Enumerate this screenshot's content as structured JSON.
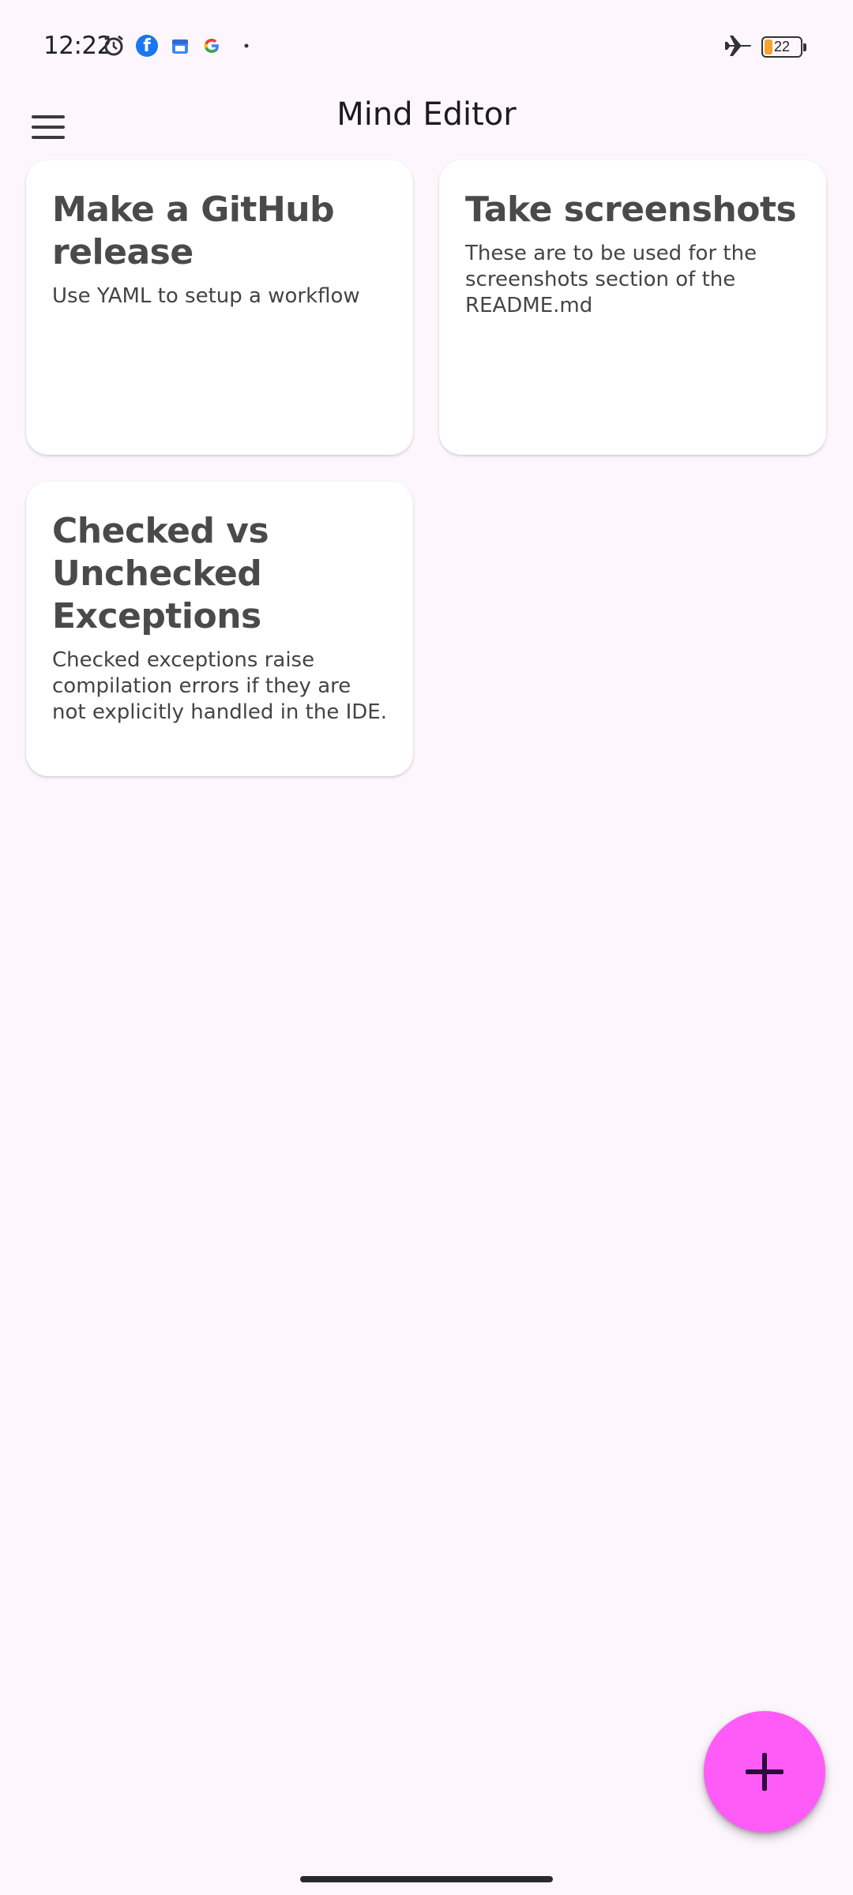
{
  "status_bar": {
    "time": "12:22",
    "icons": [
      "alarm-icon",
      "facebook-icon",
      "calendar-icon",
      "google-icon",
      "dot-icon",
      "airplane-mode-icon",
      "battery-icon"
    ],
    "battery_level": "22",
    "battery_color": "#f3a530"
  },
  "app_bar": {
    "title": "Mind Editor",
    "menu_icon": "hamburger-menu-icon"
  },
  "notes": [
    {
      "title": "Make a GitHub release",
      "body": "Use YAML to setup a workflow"
    },
    {
      "title": "Take screenshots",
      "body": "These are to be used for the screenshots section of the README.md"
    },
    {
      "title": "Checked vs Unchecked Exceptions",
      "body": "Checked exceptions raise compilation errors if they are not explicitly handled in the IDE."
    }
  ],
  "fab": {
    "icon": "plus-icon",
    "color": "#ff5cf7"
  },
  "colors": {
    "background": "#fdf7fd",
    "card": "#ffffff",
    "fab_icon": "#2b0a3d"
  }
}
